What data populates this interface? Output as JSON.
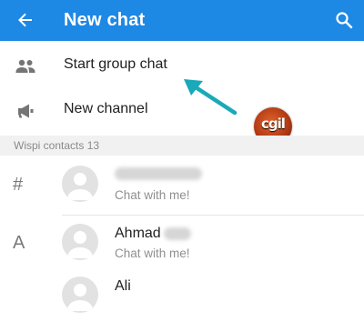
{
  "appbar": {
    "title": "New chat",
    "back_icon": "arrow-left-icon",
    "search_icon": "search-icon",
    "color": "#1e88e5"
  },
  "actions": [
    {
      "label": "Start group chat",
      "icon": "group-icon"
    },
    {
      "label": "New channel",
      "icon": "megaphone-icon"
    }
  ],
  "annotation": {
    "logo_text": "cgil"
  },
  "contacts_section": {
    "header": "Wispi contacts 13",
    "rows": [
      {
        "index_letter": "#",
        "name": "",
        "status": "Chat with me!"
      },
      {
        "index_letter": "A",
        "name": "Ahmad",
        "status": "Chat with me!"
      },
      {
        "index_letter": "",
        "name": "Ali",
        "status": ""
      }
    ]
  }
}
